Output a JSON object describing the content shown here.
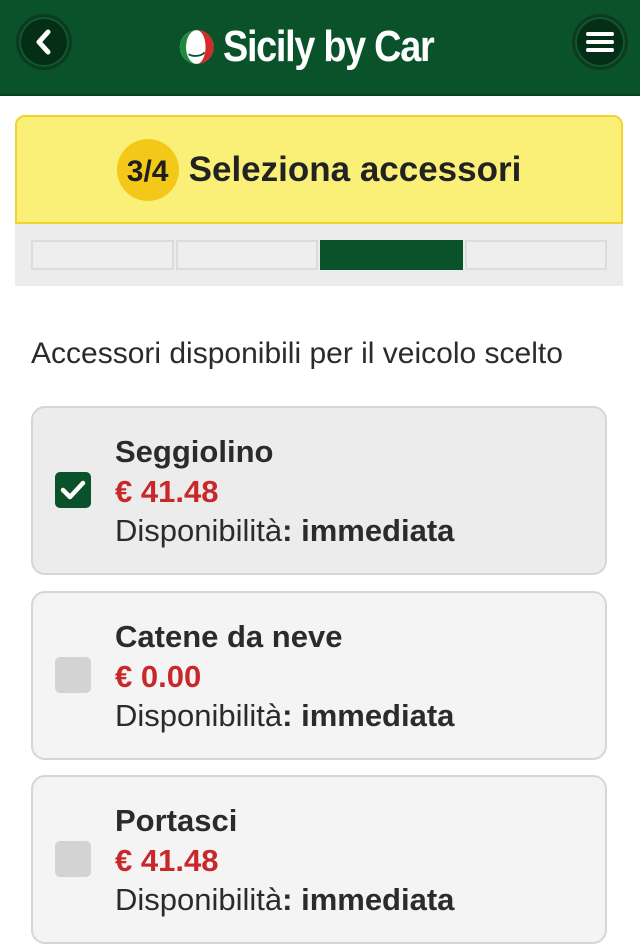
{
  "header": {
    "brand": "Sicily by Car",
    "back_icon": "chevron-left-icon",
    "menu_icon": "hamburger-menu-icon",
    "colors": {
      "header_bg": "#0a5229",
      "button_bg": "#052e17"
    }
  },
  "step": {
    "badge": "3/4",
    "title": "Seleziona accessori",
    "current": 3,
    "total": 4,
    "colors": {
      "banner_bg": "#fbf077",
      "badge_bg": "#f4c819",
      "progress_active": "#0a5229"
    }
  },
  "subtitle": "Accessori disponibili per il veicolo scelto",
  "accessories": [
    {
      "name": "Seggiolino",
      "price": "€ 41.48",
      "availability_label": "Disponibilità",
      "availability_value": ": immediata",
      "checked": true
    },
    {
      "name": "Catene da neve",
      "price": "€ 0.00",
      "availability_label": "Disponibilità",
      "availability_value": ": immediata",
      "checked": false
    },
    {
      "name": "Portasci",
      "price": "€ 41.48",
      "availability_label": "Disponibilità",
      "availability_value": ": immediata",
      "checked": false
    }
  ],
  "colors": {
    "price": "#c8282a",
    "checkbox_checked": "#0a5229"
  }
}
